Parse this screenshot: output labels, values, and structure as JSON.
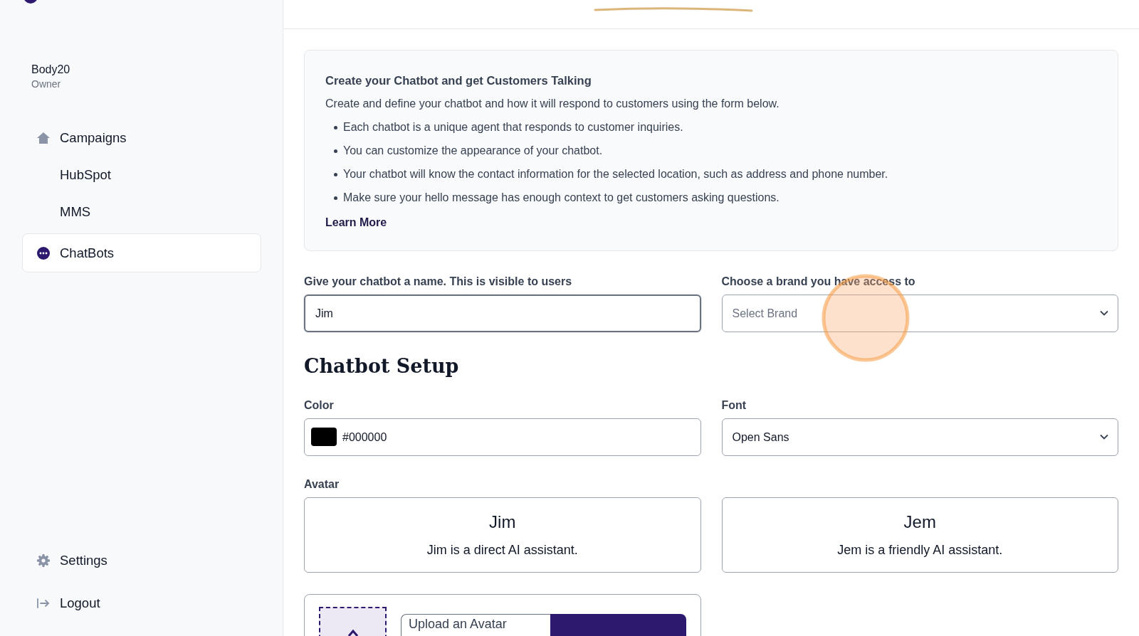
{
  "sidebar": {
    "user": {
      "name": "Body20",
      "role": "Owner"
    },
    "items": [
      {
        "label": "Campaigns",
        "selected": false,
        "children": [
          {
            "label": "HubSpot",
            "selected": false
          },
          {
            "label": "MMS",
            "selected": false
          }
        ]
      },
      {
        "label": "ChatBots",
        "selected": true
      }
    ],
    "footer": [
      {
        "label": "Settings"
      },
      {
        "label": "Logout"
      }
    ]
  },
  "info": {
    "title": "Create your Chatbot and get Customers Talking",
    "intro": "Create and define your chatbot and how it will respond to customers using the form below.",
    "bullets": [
      "Each chatbot is a unique agent that responds to customer inquiries.",
      "You can customize the appearance of your chatbot.",
      "Your chatbot will know the contact information for the selected location, such as address and phone number.",
      "Make sure your hello message has enough context to get customers asking questions."
    ],
    "link": "Learn More"
  },
  "name_field": {
    "label": "Give your chatbot a name. This is visible to users",
    "value": "Jim"
  },
  "brand_field": {
    "label": "Choose a brand you have access to",
    "placeholder": "Select Brand"
  },
  "section_title": "Chatbot Setup",
  "color_field": {
    "label": "Color",
    "value": "#000000"
  },
  "font_field": {
    "label": "Font",
    "value": "Open Sans"
  },
  "avatar": {
    "label": "Avatar",
    "options": [
      {
        "name": "Jim",
        "description": "Jim is a direct AI assistant."
      },
      {
        "name": "Jem",
        "description": "Jem is a friendly AI assistant."
      }
    ]
  },
  "upload": {
    "placeholder": "Upload an Avatar"
  }
}
